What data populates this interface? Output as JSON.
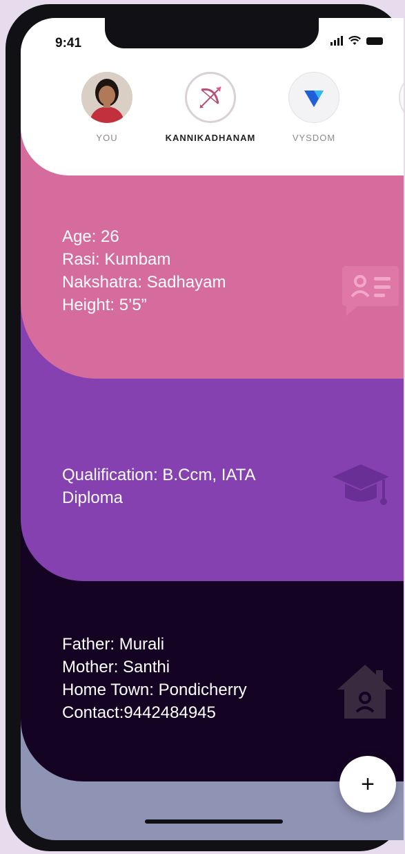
{
  "status_bar": {
    "time": "9:41"
  },
  "stories": [
    {
      "label": "YOU",
      "active": false
    },
    {
      "label": "KANNIKADHANAM",
      "active": true
    },
    {
      "label": "VYSDOM",
      "active": false
    }
  ],
  "personal": {
    "age": "Age: 26",
    "rasi": "Rasi: Kumbam",
    "nakshatra": "Nakshatra: Sadhayam",
    "height": "Height: 5’5”",
    "icon": "id-card-icon"
  },
  "education": {
    "qualification_line1": "Qualification: B.Ccm, IATA",
    "qualification_line2": "Diploma",
    "icon": "graduation-cap-icon"
  },
  "family": {
    "father": "Father: Murali",
    "mother": "Mother: Santhi",
    "home_town": "Home Town: Pondicherry",
    "contact": "Contact:9442484945",
    "icon": "home-icon"
  },
  "fab": {
    "label": "+"
  },
  "colors": {
    "personal": "#d66b9d",
    "education": "#8641b0",
    "family": "#150324",
    "bottom": "#8f93b4"
  }
}
